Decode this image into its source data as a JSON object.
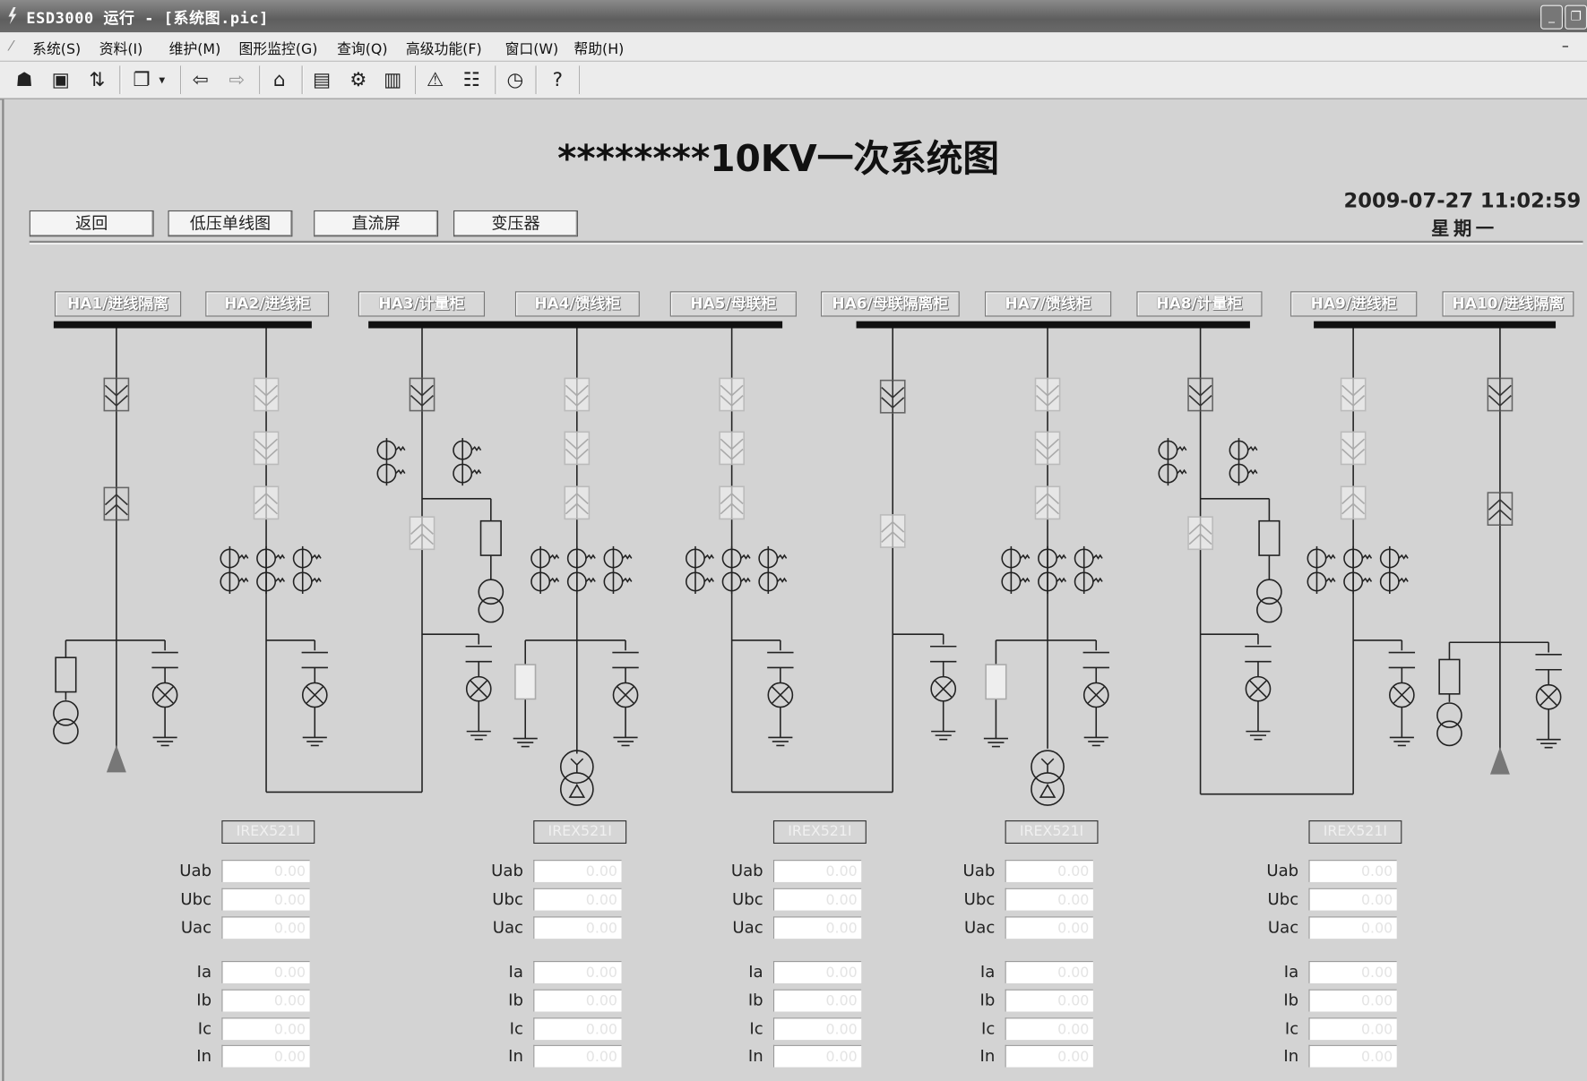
{
  "window": {
    "title": "ESD3000 运行 - [系统图.pic]",
    "minimize": "_",
    "restore": "❐",
    "mdi_minimize": "–"
  },
  "menu": [
    "系统(S)",
    "资料(I)",
    "维护(M)",
    "图形监控(G)",
    "查询(Q)",
    "高级功能(F)",
    "窗口(W)",
    "帮助(H)"
  ],
  "toolbar": [
    {
      "icon": "user-login-icon",
      "glyph": "☗"
    },
    {
      "icon": "computer-icon",
      "glyph": "▣"
    },
    {
      "icon": "switch-icon",
      "glyph": "⇅"
    },
    {
      "icon": "windows-icon",
      "glyph": "❐"
    },
    {
      "icon": "dropdown-icon",
      "glyph": "▾"
    },
    {
      "icon": "back-arrow-icon",
      "glyph": "⇦"
    },
    {
      "icon": "forward-arrow-icon",
      "glyph": "⇨"
    },
    {
      "icon": "home-icon",
      "glyph": "⌂"
    },
    {
      "icon": "picture-icon",
      "glyph": "▤"
    },
    {
      "icon": "settings-icon",
      "glyph": "⚙"
    },
    {
      "icon": "folder-icon",
      "glyph": "▥"
    },
    {
      "icon": "alarm-icon",
      "glyph": "⚠"
    },
    {
      "icon": "layout-icon",
      "glyph": "☷"
    },
    {
      "icon": "clock-icon",
      "glyph": "◷"
    },
    {
      "icon": "help-icon",
      "glyph": "?"
    }
  ],
  "page": {
    "title": "********10KV一次系统图",
    "datetime": "2009-07-27 11:02:59",
    "weekday": "星期一"
  },
  "nav_buttons": [
    "返回",
    "低压单线图",
    "直流屏",
    "变压器"
  ],
  "cabinets": [
    "HA1/进线隔离",
    "HA2/进线柜",
    "HA3/计量柜",
    "HA4/馈线柜",
    "HA5/母联柜",
    "HA6/母联隔离柜",
    "HA7/馈线柜",
    "HA8/计量柜",
    "HA9/进线柜",
    "HA10/进线隔离"
  ],
  "panels": [
    {
      "device": "IREX521I",
      "fields": [
        {
          "label": "Uab",
          "value": "0.00"
        },
        {
          "label": "Ubc",
          "value": "0.00"
        },
        {
          "label": "Uac",
          "value": "0.00"
        },
        {
          "label": "Ia",
          "value": "0.00"
        },
        {
          "label": "Ib",
          "value": "0.00"
        },
        {
          "label": "Ic",
          "value": "0.00"
        },
        {
          "label": "In",
          "value": "0.00"
        }
      ]
    },
    {
      "device": "IREX521I",
      "fields": [
        {
          "label": "Uab",
          "value": "0.00"
        },
        {
          "label": "Ubc",
          "value": "0.00"
        },
        {
          "label": "Uac",
          "value": "0.00"
        },
        {
          "label": "Ia",
          "value": "0.00"
        },
        {
          "label": "Ib",
          "value": "0.00"
        },
        {
          "label": "Ic",
          "value": "0.00"
        },
        {
          "label": "In",
          "value": "0.00"
        }
      ]
    },
    {
      "device": "IREX521I",
      "fields": [
        {
          "label": "Uab",
          "value": "0.00"
        },
        {
          "label": "Ubc",
          "value": "0.00"
        },
        {
          "label": "Uac",
          "value": "0.00"
        },
        {
          "label": "Ia",
          "value": "0.00"
        },
        {
          "label": "Ib",
          "value": "0.00"
        },
        {
          "label": "Ic",
          "value": "0.00"
        },
        {
          "label": "In",
          "value": "0.00"
        }
      ]
    },
    {
      "device": "IREX521I",
      "fields": [
        {
          "label": "Uab",
          "value": "0.00"
        },
        {
          "label": "Ubc",
          "value": "0.00"
        },
        {
          "label": "Uac",
          "value": "0.00"
        },
        {
          "label": "Ia",
          "value": "0.00"
        },
        {
          "label": "Ib",
          "value": "0.00"
        },
        {
          "label": "Ic",
          "value": "0.00"
        },
        {
          "label": "In",
          "value": "0.00"
        }
      ]
    },
    {
      "device": "IREX521I",
      "fields": [
        {
          "label": "Uab",
          "value": "0.00"
        },
        {
          "label": "Ubc",
          "value": "0.00"
        },
        {
          "label": "Uac",
          "value": "0.00"
        },
        {
          "label": "Ia",
          "value": "0.00"
        },
        {
          "label": "Ib",
          "value": "0.00"
        },
        {
          "label": "Ic",
          "value": "0.00"
        },
        {
          "label": "In",
          "value": "0.00"
        }
      ]
    }
  ]
}
